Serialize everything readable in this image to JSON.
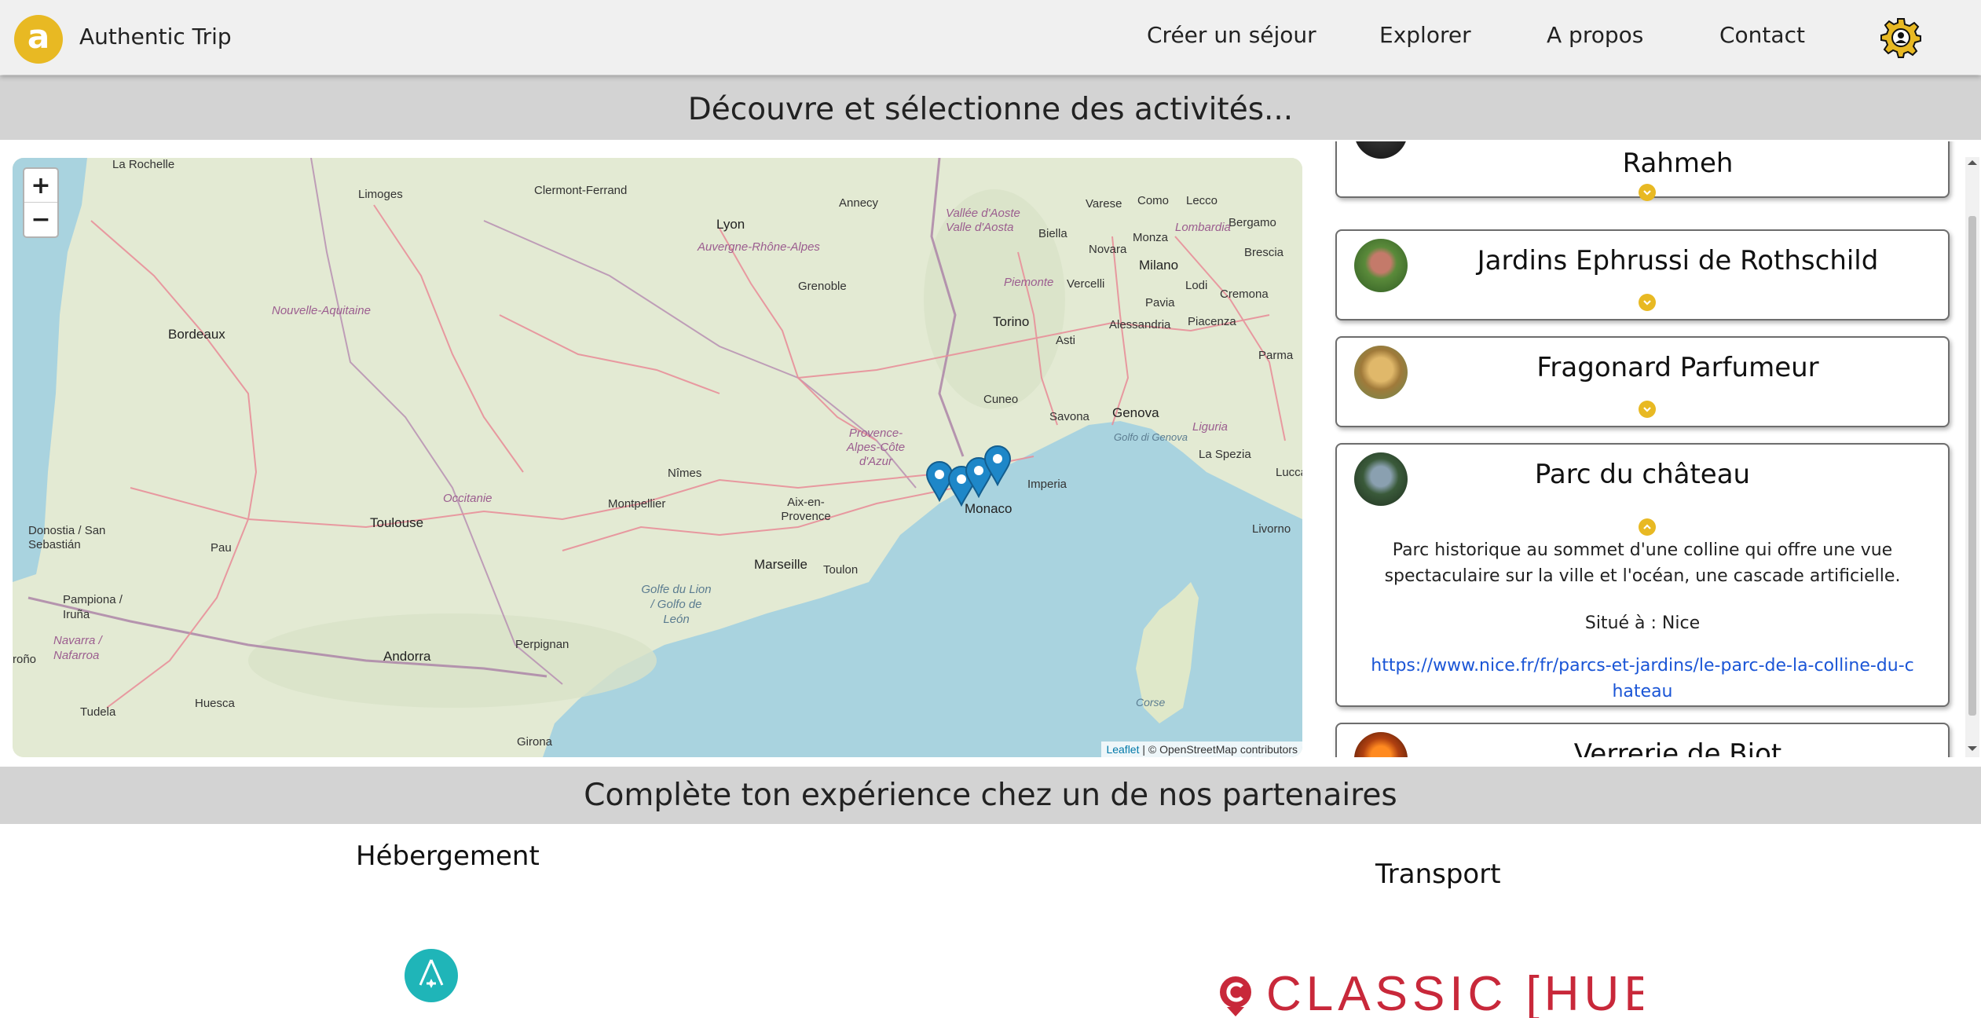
{
  "header": {
    "logo_letter": "a",
    "brand": "Authentic Trip",
    "nav": [
      "Créer un séjour",
      "Explorer",
      "A propos",
      "Contact"
    ],
    "settings_icon": "gear-icon",
    "accent": "#e8b923"
  },
  "activities_banner": "Découvre et sélectionne des activités...",
  "map": {
    "zoom_in": "+",
    "zoom_out": "−",
    "attribution_link": "Leaflet",
    "attribution_text": " | © OpenStreetMap contributors",
    "pin_icon": "map-marker-icon",
    "pin_color": "#1e87c8",
    "place_labels": [
      "La Rochelle",
      "Limoges",
      "Clermont-Ferrand",
      "Lyon",
      "Annecy",
      "Vallée d'Aoste",
      "Valle d'Aosta",
      "Varese",
      "Como",
      "Lecco",
      "Bergamo",
      "Brescia",
      "Biella",
      "Novara",
      "Monza",
      "Milano",
      "Lombardia",
      "Auvergne-Rhône-Alpes",
      "Grenoble",
      "Piemonte",
      "Vercelli",
      "Pavia",
      "Lodi",
      "Cremona",
      "Nouvelle-Aquitaine",
      "Bordeaux",
      "Torino",
      "Asti",
      "Alessandria",
      "Piacenza",
      "Parma",
      "Cuneo",
      "Savona",
      "Genova",
      "Liguria",
      "Golfo di Genova",
      "Provence-Alpes-Côte d'Azur",
      "Nîmes",
      "Imperia",
      "La Spezia",
      "Lucca",
      "Occitanie",
      "Montpellier",
      "Aix-en-Provence",
      "Monaco",
      "Toulouse",
      "Donostia / San Sebastián",
      "Pau",
      "Marseille",
      "Toulon",
      "Livorno",
      "Golfe du Lion / Golfo de León",
      "Pampiona / Iruña",
      "Navarra / Nafarroa",
      "Andorra",
      "Perpignan",
      "Corse",
      "Huesca",
      "Tudela",
      "Girona",
      "roño"
    ]
  },
  "activities": [
    {
      "title": "Rahmeh",
      "expanded": false
    },
    {
      "title": "Jardins Ephrussi de Rothschild",
      "expanded": false
    },
    {
      "title": "Fragonard Parfumeur",
      "expanded": false
    },
    {
      "title": "Parc du château",
      "expanded": true,
      "description": "Parc historique au sommet d'une colline qui offre une vue spectaculaire sur la ville et l'océan, une cascade artificielle.",
      "location": "Situé à : Nice",
      "link": "https://www.nice.fr/fr/parcs-et-jardins/le-parc-de-la-colline-du-chateau"
    },
    {
      "title": "Verrerie de Biot",
      "expanded": false
    }
  ],
  "partners_banner": "Complète ton expérience chez un de nos partenaires",
  "partners": {
    "accommodation_title": "Hébergement",
    "transport_title": "Transport",
    "transport_logo_text": "CLASSIC [HUB]",
    "accommodation_logo_color": "#1fb5b8",
    "transport_logo_color": "#c8283a"
  }
}
